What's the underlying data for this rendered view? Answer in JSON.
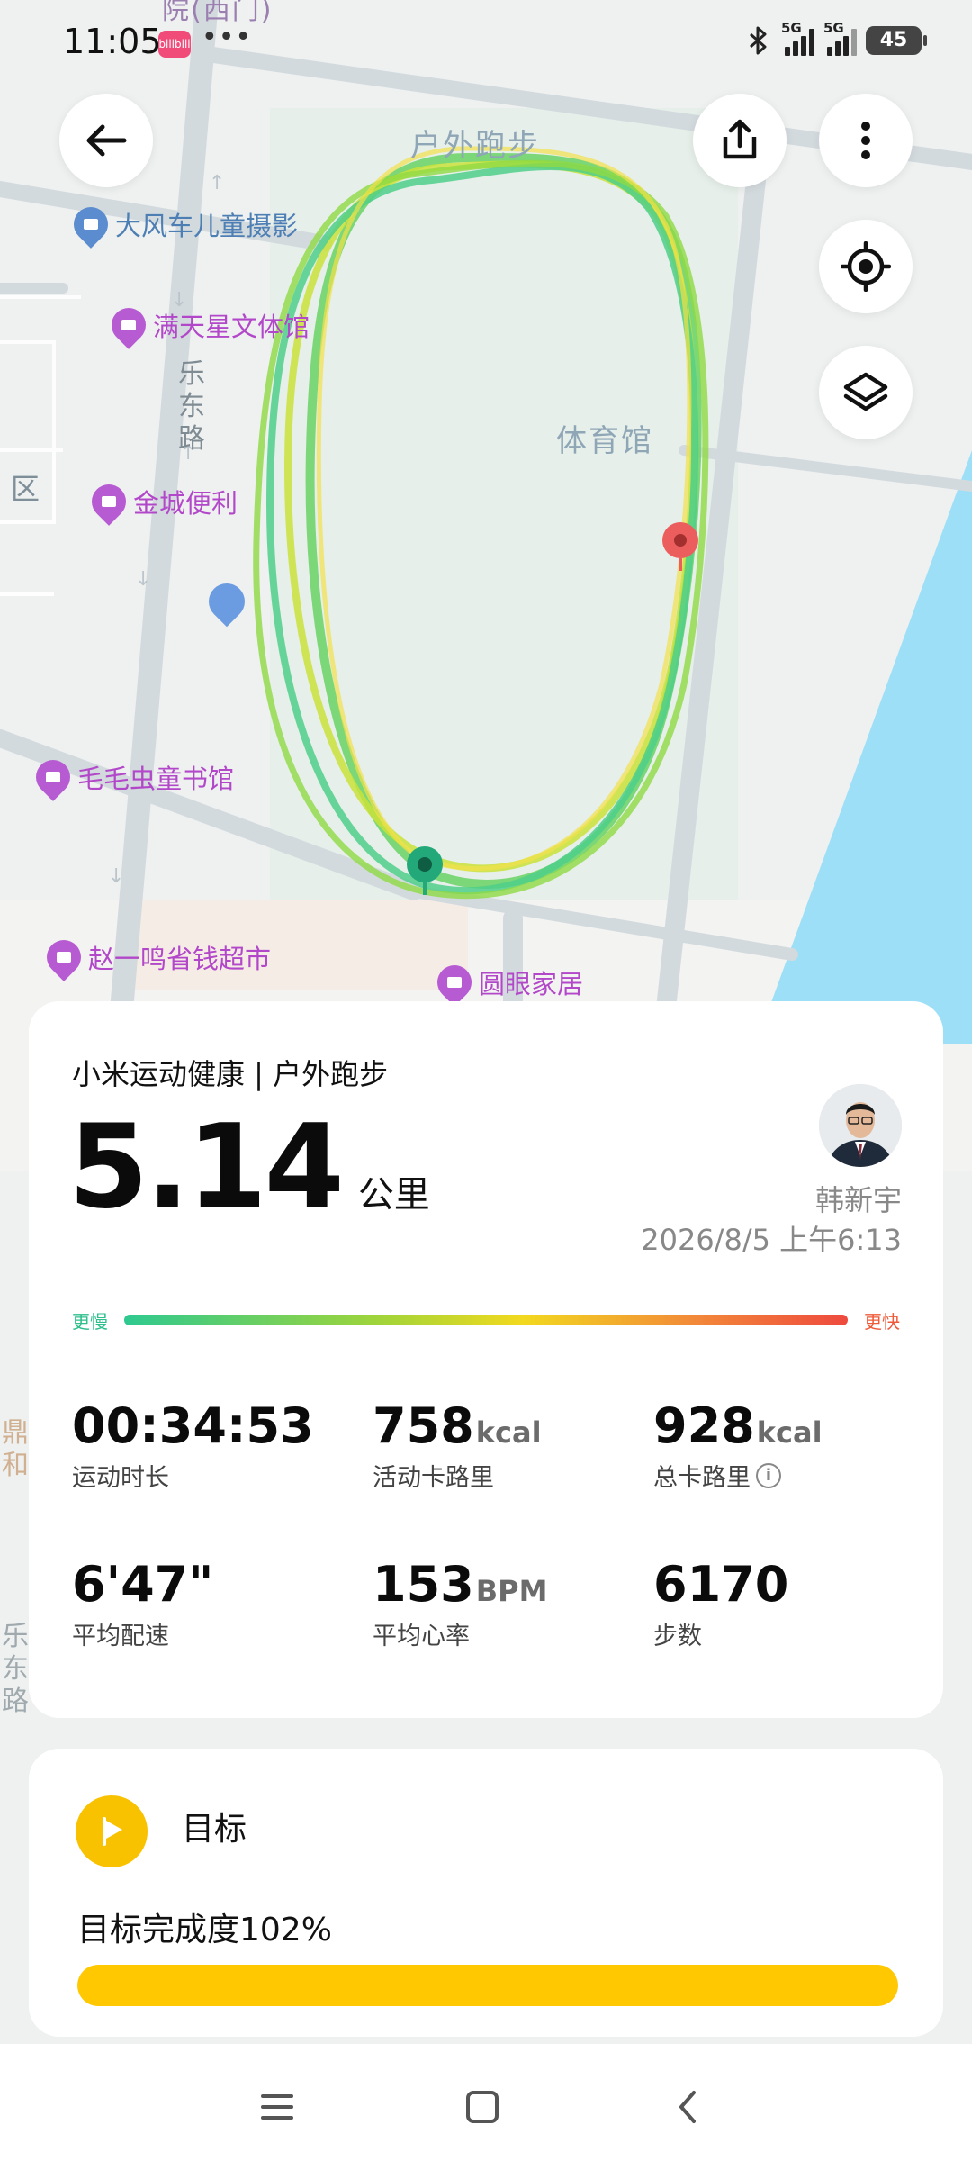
{
  "status_bar": {
    "time": "11:05",
    "app_badge": "bilibili",
    "dots": "•••",
    "network_1": "5G",
    "network_2": "5G",
    "battery": "45"
  },
  "map": {
    "top_label": "户外跑步",
    "partial_top_label": "院(西门)",
    "venue_label": "体育馆",
    "road_label": "乐东路",
    "road_label_2": "乐东路",
    "district_label": "区",
    "pois": [
      {
        "name": "大风车儿童摄影",
        "kind": "camera-icon"
      },
      {
        "name": "满天星文体馆",
        "kind": "store-icon"
      },
      {
        "name": "金城便利",
        "kind": "cart-icon"
      },
      {
        "name": "毛毛虫童书馆",
        "kind": "store-icon"
      },
      {
        "name": "赵一鸣省钱超市",
        "kind": "cart-icon"
      },
      {
        "name": "圆眼家居",
        "kind": "store-icon"
      }
    ],
    "side_label": "鼎和",
    "route_color": "#7fd45a",
    "start_marker_color": "#23a87a",
    "end_marker_color": "#e85a5a"
  },
  "summary": {
    "source": "小米运动健康 | 户外跑步",
    "distance_value": "5.14",
    "distance_unit": "公里",
    "user_name": "韩新宇",
    "datetime": "2026/8/5 上午6:13",
    "pace_slow_label": "更慢",
    "pace_fast_label": "更快",
    "metrics": [
      {
        "value": "00:34:53",
        "unit": "",
        "label": "运动时长"
      },
      {
        "value": "758",
        "unit": "kcal",
        "label": "活动卡路里"
      },
      {
        "value": "928",
        "unit": "kcal",
        "label": "总卡路里"
      },
      {
        "value": "6'47\"",
        "unit": "",
        "label": "平均配速"
      },
      {
        "value": "153",
        "unit": "BPM",
        "label": "平均心率"
      },
      {
        "value": "6170",
        "unit": "",
        "label": "步数"
      }
    ],
    "info_icon_glyph": "i"
  },
  "goal": {
    "title": "目标",
    "completion_text": "目标完成度102%",
    "completion_fraction": 1.0,
    "bar_color": "#ffc800"
  },
  "colors": {
    "goal_yellow": "#f9c200",
    "pace_slow": "#2dbf8c",
    "pace_fast": "#ef5b3a"
  }
}
